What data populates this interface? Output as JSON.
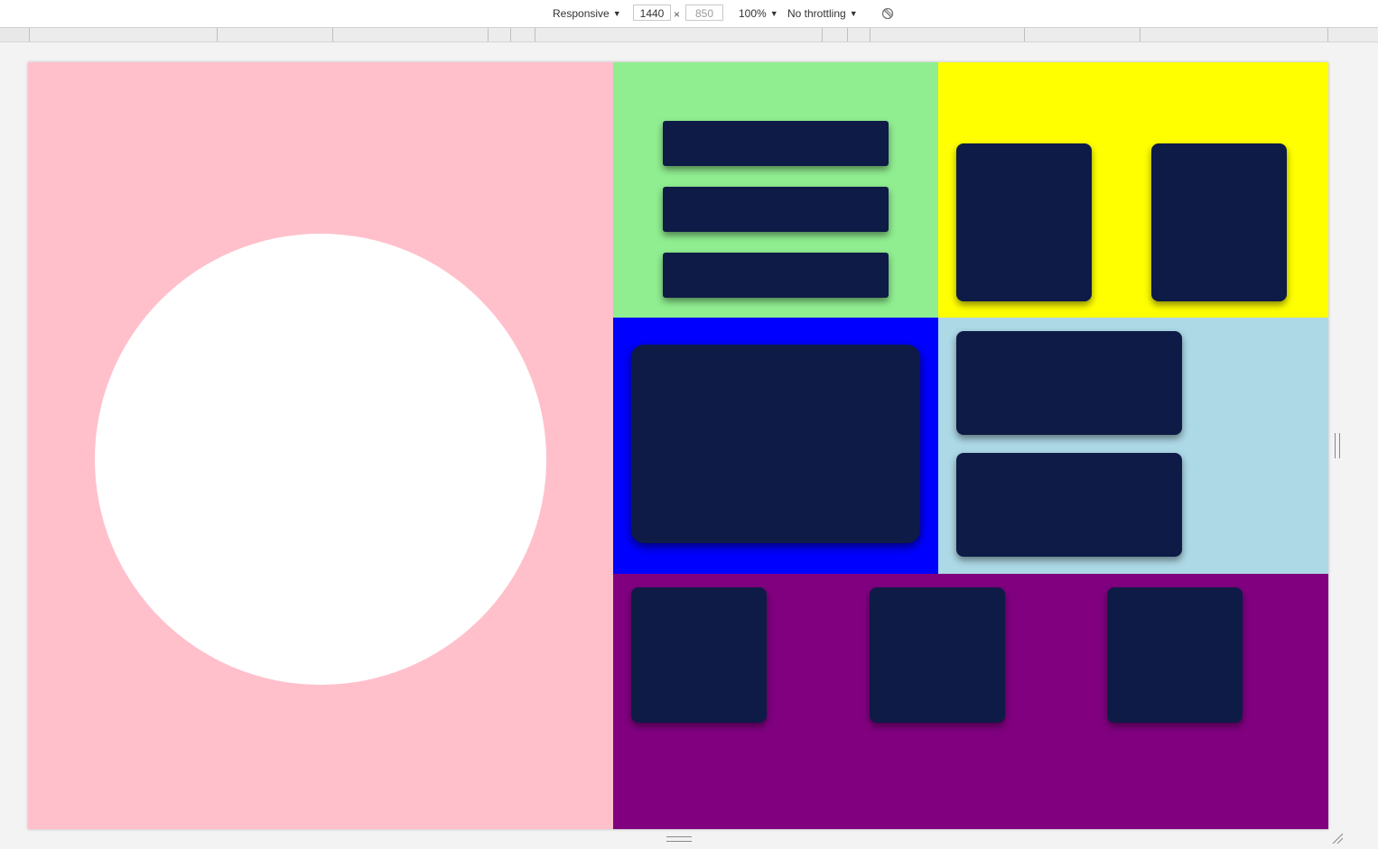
{
  "toolbar": {
    "device_mode": "Responsive",
    "width": "1440",
    "height_placeholder": "850",
    "dimension_separator": "×",
    "zoom": "100%",
    "throttling": "No throttling",
    "rotate_icon": "rotate-disabled-icon"
  },
  "viewport": {
    "panels": [
      {
        "name": "pink-panel",
        "color": "#ffc0cb"
      },
      {
        "name": "green-panel",
        "color": "#90ee90"
      },
      {
        "name": "yellow-panel",
        "color": "#ffff00"
      },
      {
        "name": "blue-panel",
        "color": "#0000ff"
      },
      {
        "name": "light-blue-panel",
        "color": "#add8e6"
      },
      {
        "name": "purple-panel",
        "color": "#800080"
      }
    ],
    "circle_color": "#ffffff",
    "box_color": "#0d1b46"
  }
}
